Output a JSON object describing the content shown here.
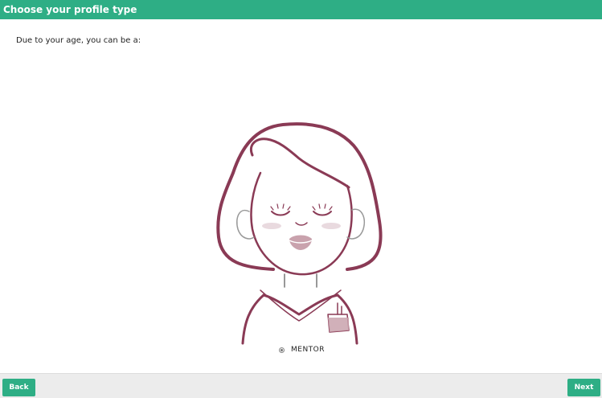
{
  "header": {
    "title": "Choose your profile type"
  },
  "main": {
    "prompt": "Due to your age, you can be a:",
    "options": [
      {
        "label": "MENTOR",
        "selected": true
      }
    ],
    "illustration_icon": "mentor-avatar-icon"
  },
  "footer": {
    "back_label": "Back",
    "next_label": "Next"
  },
  "colors": {
    "accent": "#2eae85",
    "illustration_stroke": "#8a3a55",
    "illustration_fill": "#c9a2ad"
  }
}
